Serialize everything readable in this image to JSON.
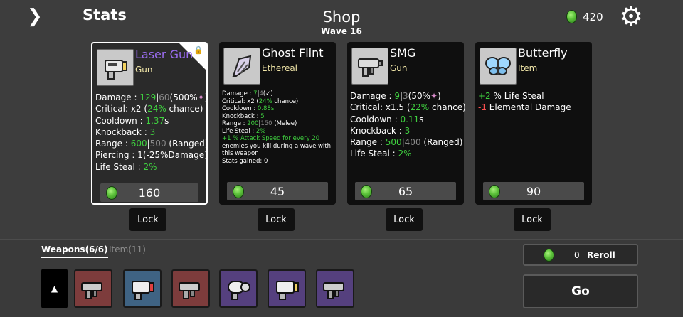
{
  "header": {
    "back_icon": "chevron-right-icon",
    "stats_label": "Stats",
    "shop_title": "Shop",
    "wave": "Wave 16",
    "currency": "420",
    "settings_icon": "gear-icon"
  },
  "cards": [
    {
      "name": "Laser Gun",
      "type": "Gun",
      "name_color": "#9a6cf0",
      "icon": "laser-gun-icon",
      "selected": true,
      "locked": true,
      "price": "160",
      "stats": {
        "damage_label": "Damage : ",
        "damage": "129",
        "damage_base": "60",
        "damage_pct": "(500%",
        "critical_label": "Critical: x2 (",
        "critical_pct": "24%",
        "critical_tail": " chance)",
        "cooldown_label": "Cooldown : ",
        "cooldown": "1.37",
        "cooldown_unit": "s",
        "knockback_label": "Knockback : ",
        "knockback": "3",
        "range_label": "Range : ",
        "range": "600",
        "range_base": "500",
        "range_tail": " (Ranged)",
        "piercing": "Piercing : 1(-25%Damage)",
        "lifesteal_label": "Life Steal : ",
        "lifesteal": "2%"
      }
    },
    {
      "name": "Ghost Flint",
      "type": "Ethereal",
      "icon": "ghost-flint-icon",
      "price": "45",
      "stats": {
        "damage_label": "Damage : ",
        "damage": "7",
        "damage_base": "4",
        "damage_tail": "(",
        "critical_label": "Critical: x2 (",
        "critical_pct": "24%",
        "critical_tail": " chance)",
        "cooldown_label": "Cooldown : ",
        "cooldown": "0.88s",
        "knockback_label": "Knockback : ",
        "knockback": "5",
        "range_label": "Range : ",
        "range": "200",
        "range_base": "150",
        "range_tail": " (Melee)",
        "lifesteal_label": "Life Steal : ",
        "lifesteal": "2%",
        "effect_prefix": "+1  % Attack Speed for every ",
        "effect_count": "20",
        "effect_tail": " enemies you kill during a wave with this weapon",
        "gained": "Stats gained: 0"
      }
    },
    {
      "name": "SMG",
      "type": "Gun",
      "icon": "smg-icon",
      "price": "65",
      "stats": {
        "damage_label": "Damage : ",
        "damage": "9",
        "damage_base": "3",
        "damage_pct": "(50%",
        "critical_label": "Critical: x1.5 (",
        "critical_pct": "22%",
        "critical_tail": " chance)",
        "cooldown_label": "Cooldown : ",
        "cooldown": "0.11",
        "cooldown_unit": "s",
        "knockback_label": "Knockback : ",
        "knockback": "3",
        "range_label": "Range : ",
        "range": "500",
        "range_base": "400",
        "range_tail": " (Ranged)",
        "lifesteal_label": "Life Steal : ",
        "lifesteal": "2%"
      }
    },
    {
      "name": "Butterfly",
      "type": "Item",
      "icon": "butterfly-icon",
      "price": "90",
      "stats": {
        "line1_value": "+2",
        "line1_tail": " % Life Steal",
        "line2_value": "-1",
        "line2_tail": " Elemental Damage"
      }
    }
  ],
  "lock_label": "Lock",
  "inventory": {
    "tab_weapons": "Weapons(6/6)",
    "tab_items": "Item(11)",
    "slots": [
      {
        "icon": "smg-icon",
        "tier_color": "#7d3c3c"
      },
      {
        "icon": "laser-gun-icon",
        "tier_color": "#3f6383"
      },
      {
        "icon": "smg-icon",
        "tier_color": "#7d3c3c"
      },
      {
        "icon": "laser-gun-icon",
        "tier_color": "#55407e"
      },
      {
        "icon": "laser-gun-icon",
        "tier_color": "#55407e"
      },
      {
        "icon": "smg-icon",
        "tier_color": "#55407e"
      }
    ]
  },
  "reroll": {
    "cost": "0",
    "label": "Reroll"
  },
  "go_label": "Go",
  "colors": {
    "green": "#3fd13f",
    "red": "#ff5050",
    "muted": "#8a8a8a",
    "type": "#f1e6a8"
  }
}
